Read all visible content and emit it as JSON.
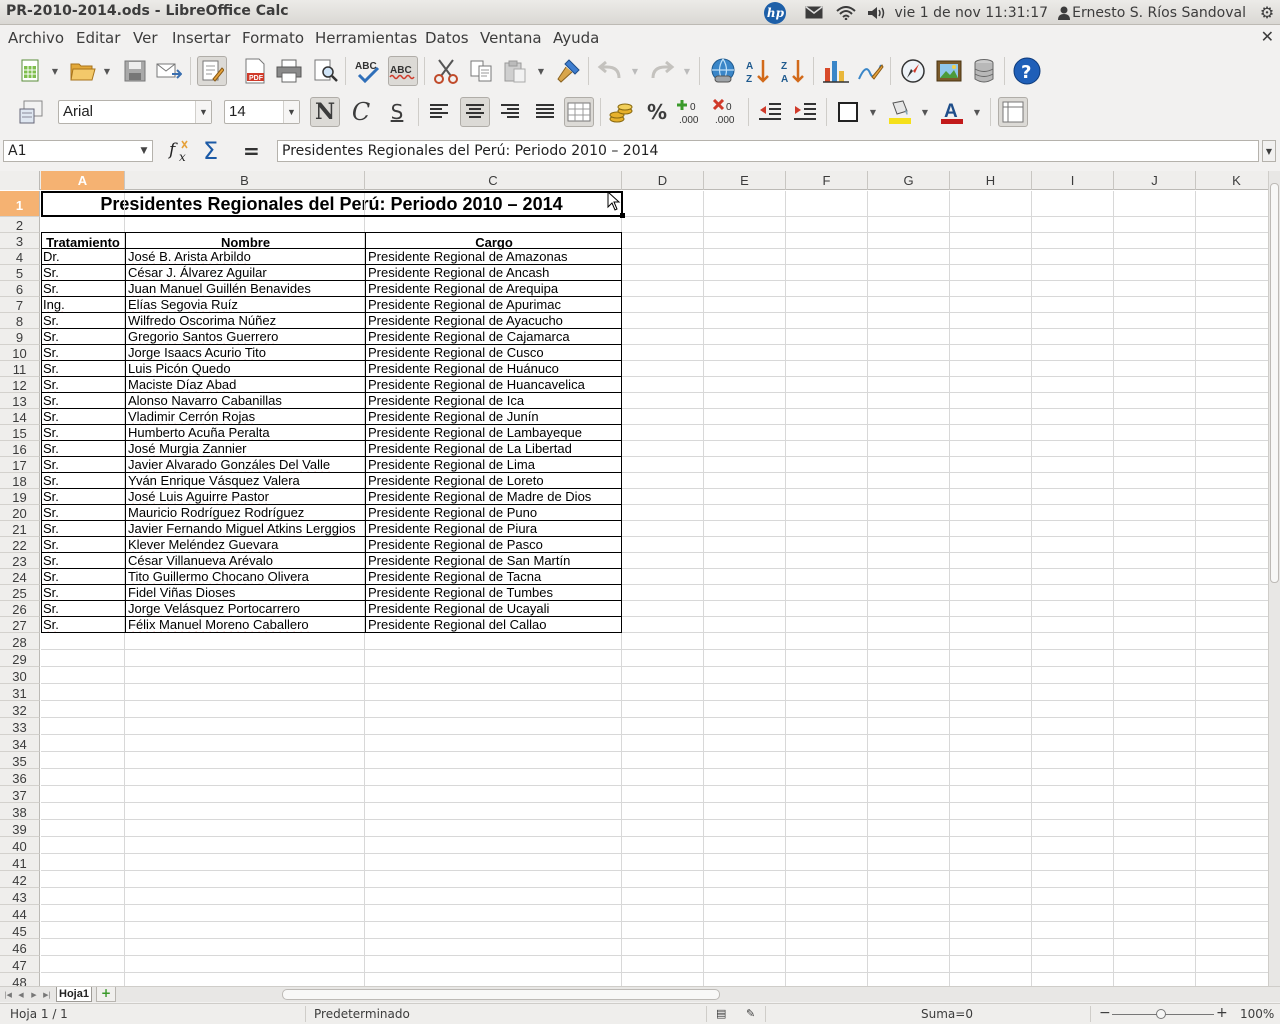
{
  "window": {
    "title": "PR-2010-2014.ods - LibreOffice Calc"
  },
  "tray": {
    "datetime": "vie  1 de nov 11:31:17",
    "user": "Ernesto S. Ríos Sandoval",
    "hp_label": "hp"
  },
  "menu": [
    "Archivo",
    "Editar",
    "Ver",
    "Insertar",
    "Formato",
    "Herramientas",
    "Datos",
    "Ventana",
    "Ayuda"
  ],
  "formatting": {
    "font_name": "Arial",
    "font_size": "14",
    "bold_glyph": "N",
    "italic_glyph": "C",
    "underline_glyph": "S"
  },
  "formula_bar": {
    "name_box": "A1",
    "content": "Presidentes Regionales del Perú: Periodo 2010 – 2014"
  },
  "columns": [
    "A",
    "B",
    "C",
    "D",
    "E",
    "F",
    "G",
    "H",
    "I",
    "J",
    "K"
  ],
  "sheet": {
    "title": "Presidentes Regionales del Perú: Periodo 2010 – 2014",
    "headers": [
      "Tratamiento",
      "Nombre",
      "Cargo"
    ],
    "rows": [
      [
        "Dr.",
        "José B. Arista Arbildo",
        "Presidente Regional de Amazonas"
      ],
      [
        "Sr.",
        "César J. Álvarez Aguilar",
        "Presidente Regional de Ancash"
      ],
      [
        "Sr.",
        "Juan Manuel Guillén Benavides",
        "Presidente Regional de Arequipa"
      ],
      [
        "Ing.",
        "Elías Segovia Ruíz",
        "Presidente Regional de Apurimac"
      ],
      [
        "Sr.",
        "Wilfredo Oscorima Núñez",
        "Presidente Regional de Ayacucho"
      ],
      [
        "Sr.",
        "Gregorio Santos Guerrero",
        "Presidente Regional de Cajamarca"
      ],
      [
        "Sr.",
        "Jorge Isaacs Acurio Tito",
        "Presidente Regional de Cusco"
      ],
      [
        "Sr.",
        "Luis Picón Quedo",
        "Presidente Regional de Huánuco"
      ],
      [
        "Sr.",
        "Maciste Díaz Abad",
        "Presidente Regional de Huancavelica"
      ],
      [
        "Sr.",
        "Alonso Navarro Cabanillas",
        "Presidente Regional de Ica"
      ],
      [
        "Sr.",
        "Vladimir Cerrón Rojas",
        "Presidente Regional de Junín"
      ],
      [
        "Sr.",
        "Humberto Acuña Peralta",
        "Presidente Regional de Lambayeque"
      ],
      [
        "Sr.",
        "José Murgia Zannier",
        "Presidente Regional de La Libertad"
      ],
      [
        "Sr.",
        "Javier Alvarado Gonzáles Del Valle",
        "Presidente Regional de Lima"
      ],
      [
        "Sr.",
        "Yván Enrique Vásquez Valera",
        "Presidente Regional de Loreto"
      ],
      [
        "Sr.",
        "José Luis Aguirre Pastor",
        "Presidente Regional de Madre de Dios"
      ],
      [
        "Sr.",
        "Mauricio Rodríguez Rodríguez",
        "Presidente Regional de Puno"
      ],
      [
        "Sr.",
        "Javier Fernando Miguel Atkins Lerggios",
        "Presidente Regional de Piura"
      ],
      [
        "Sr.",
        "Klever Meléndez Guevara",
        "Presidente Regional de Pasco"
      ],
      [
        "Sr.",
        "César Villanueva Arévalo",
        "Presidente Regional de San Martín"
      ],
      [
        "Sr.",
        "Tito Guillermo Chocano Olivera",
        "Presidente Regional de Tacna"
      ],
      [
        "Sr.",
        "Fidel Viñas Dioses",
        "Presidente Regional de Tumbes"
      ],
      [
        "Sr.",
        "Jorge Velásquez Portocarrero",
        "Presidente Regional de Ucayali"
      ],
      [
        "Sr.",
        "Félix Manuel Moreno Caballero",
        "Presidente Regional del Callao"
      ]
    ]
  },
  "tabs": {
    "sheet_name": "Hoja1",
    "add_label": "+"
  },
  "status": {
    "sheet_pos": "Hoja 1 / 1",
    "page_style": "Predeterminado",
    "sum": "Suma=0",
    "zoom": "100%"
  }
}
